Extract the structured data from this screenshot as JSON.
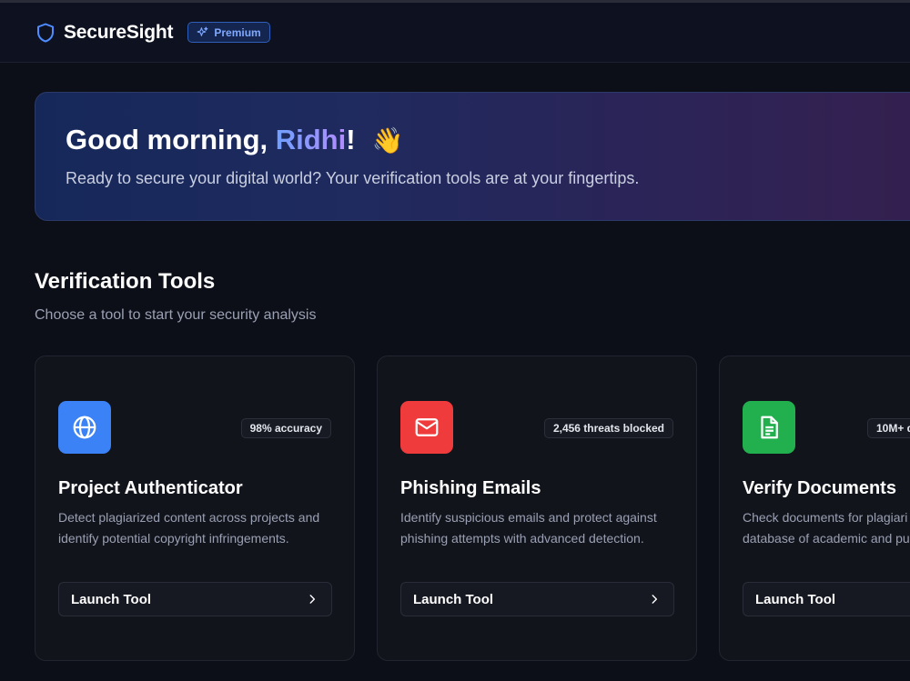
{
  "header": {
    "brand": "SecureSight",
    "premium_label": "Premium"
  },
  "welcome": {
    "greeting_prefix": "Good morning, ",
    "user_name": "Ridhi",
    "greeting_suffix": "!",
    "wave_emoji": "👋",
    "subtitle": "Ready to secure your digital world? Your verification tools are at your fingertips."
  },
  "tools_section": {
    "title": "Verification Tools",
    "subtitle": "Choose a tool to start your security analysis"
  },
  "tools": [
    {
      "icon": "globe-icon",
      "icon_color": "#3b82f6",
      "badge": "98% accuracy",
      "title": "Project Authenticator",
      "description": "Detect plagiarized content across projects and identify potential copyright infringements.",
      "launch_label": "Launch Tool"
    },
    {
      "icon": "mail-icon",
      "icon_color": "#ef4444",
      "badge": "2,456 threats blocked",
      "title": "Phishing Emails",
      "description": "Identify suspicious emails and protect against phishing attempts with advanced detection.",
      "launch_label": "Launch Tool"
    },
    {
      "icon": "document-icon",
      "icon_color": "#22c55e",
      "badge": "10M+ d",
      "title": "Verify Documents",
      "description": "Check documents for plagiari database of academic and pu",
      "launch_label": "Launch Tool"
    }
  ]
}
